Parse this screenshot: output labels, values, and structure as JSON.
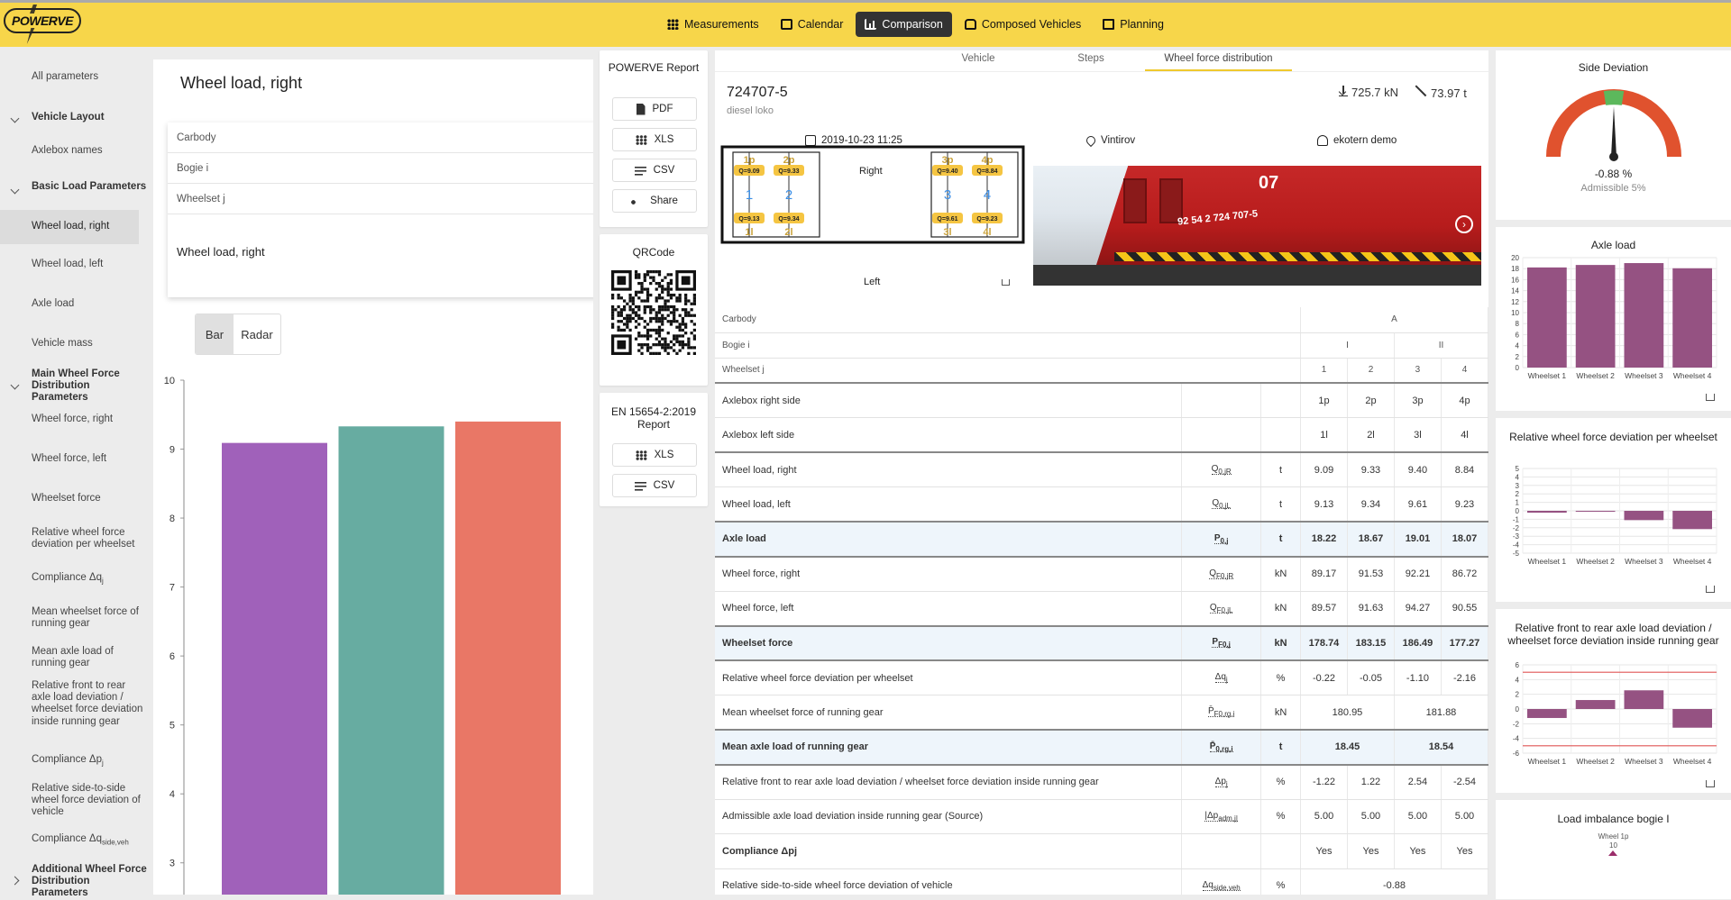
{
  "app": {
    "logo": "POWERVE"
  },
  "nav": [
    {
      "label": "Measurements",
      "icon": "grid-icon",
      "active": false
    },
    {
      "label": "Calendar",
      "icon": "calendar-icon",
      "active": false
    },
    {
      "label": "Comparison",
      "icon": "bar-chart-icon",
      "active": true
    },
    {
      "label": "Composed Vehicles",
      "icon": "train-icon",
      "active": false
    },
    {
      "label": "Planning",
      "icon": "clipboard-icon",
      "active": false
    }
  ],
  "sidebar": {
    "all": "All parameters",
    "sections": [
      {
        "label": "Vehicle Layout"
      },
      {
        "label": "Axlebox names"
      },
      {
        "label": "Basic Load Parameters"
      },
      {
        "label": "Wheel load, right"
      },
      {
        "label": "Wheel load, left"
      },
      {
        "label": "Axle load"
      },
      {
        "label": "Vehicle mass"
      },
      {
        "label": "Main Wheel Force Distribution Parameters"
      },
      {
        "label": "Wheel force, right"
      },
      {
        "label": "Wheel force, left"
      },
      {
        "label": "Wheelset force"
      },
      {
        "label": "Relative wheel force deviation per wheelset"
      },
      {
        "label": "Compliance Δq"
      },
      {
        "label": "Mean wheelset force of running gear"
      },
      {
        "label": "Mean axle load of running gear"
      },
      {
        "label": "Relative front to rear axle load deviation / wheelset force deviation inside running gear"
      },
      {
        "label": "Compliance Δp"
      },
      {
        "label": "Relative side-to-side wheel force deviation of vehicle"
      },
      {
        "label": "Compliance Δq"
      },
      {
        "label": "Additional Wheel Force Distribution Parameters"
      }
    ],
    "sub_j": "j",
    "sub_side": "side,veh"
  },
  "middle": {
    "title": "Wheel load, right",
    "filters": [
      "Carbody",
      "Bogie i",
      "Wheelset j"
    ],
    "value_label": "Wheel load, right",
    "view_bar": "Bar",
    "view_radar": "Radar"
  },
  "mid_chart": {
    "y_ticks": [
      "10",
      "9",
      "8",
      "7",
      "6",
      "5",
      "4",
      "3"
    ]
  },
  "chart_data": [
    {
      "type": "bar",
      "title": "",
      "categories": [
        "",
        "",
        ""
      ],
      "values": [
        9.09,
        9.33,
        9.4
      ],
      "ylim": [
        2.5,
        10
      ],
      "colors": [
        "#9b59b6",
        "#5fa89c",
        "#e8705e"
      ],
      "yticks": [
        3,
        4,
        5,
        6,
        7,
        8,
        9,
        10
      ]
    },
    {
      "type": "bar",
      "title": "Axle load",
      "categories": [
        "Wheelset 1",
        "Wheelset 2",
        "Wheelset 3",
        "Wheelset 4"
      ],
      "values": [
        18.22,
        18.67,
        19.01,
        18.07
      ],
      "yticks": [
        0,
        2,
        4,
        6,
        8,
        10,
        12,
        14,
        16,
        18,
        20
      ],
      "ylim": [
        0,
        20
      ]
    },
    {
      "type": "bar",
      "title": "Relative wheel force deviation per wheelset",
      "categories": [
        "Wheelset 1",
        "Wheelset 2",
        "Wheelset 3",
        "Wheelset 4"
      ],
      "values": [
        -0.22,
        -0.05,
        -1.1,
        -2.16
      ],
      "yticks": [
        5,
        4,
        3,
        2,
        1,
        0,
        -1,
        -2,
        -3,
        -4,
        -5
      ],
      "ylim": [
        -5,
        5
      ]
    },
    {
      "type": "bar",
      "title": "Relative front to rear axle load deviation / wheelset force deviation inside running gear",
      "categories": [
        "Wheelset 1",
        "Wheelset 2",
        "Wheelset 3",
        "Wheelset 4"
      ],
      "values": [
        -1.22,
        1.22,
        2.54,
        -2.54
      ],
      "yticks": [
        6,
        4,
        2,
        0,
        -2,
        -4,
        -6
      ],
      "ylim": [
        -6,
        6
      ],
      "limits": [
        5,
        -5
      ]
    }
  ],
  "report": {
    "title": "POWERVE Report",
    "pdf": "PDF",
    "xls": "XLS",
    "csv": "CSV",
    "share": "Share",
    "qr_title": "QRCode",
    "en_title": "EN 15654-2:2019 Report",
    "en_xls": "XLS",
    "en_csv": "CSV"
  },
  "tabs": [
    "Vehicle",
    "Steps",
    "Wheel force distribution"
  ],
  "vehicle": {
    "id": "724707-5",
    "type": "diesel loko",
    "force": "725.7 kN",
    "mass": "73.97 t",
    "date": "2019-10-23 11:25",
    "place": "Vintirov",
    "user": "ekotern demo",
    "right_label": "Right",
    "left_label": "Left",
    "photo_text": "92 54 2 724 707-5",
    "photo_num": "07"
  },
  "diagram": {
    "top_labels": [
      "1p",
      "2p",
      "3p",
      "4p"
    ],
    "bot_labels": [
      "1l",
      "2l",
      "3l",
      "4l"
    ],
    "q_top": [
      "Q=9.09",
      "Q=9.33",
      "Q=9.40",
      "Q=8.84"
    ],
    "q_bot": [
      "Q=9.13",
      "Q=9.34",
      "Q=9.61",
      "Q=9.23"
    ],
    "nums": [
      "1",
      "2",
      "3",
      "4"
    ]
  },
  "table": {
    "hdr": [
      {
        "label": "Carbody",
        "cells": [
          "A"
        ]
      },
      {
        "label": "Bogie i",
        "cells": [
          "I",
          "II"
        ]
      },
      {
        "label": "Wheelset j",
        "cells": [
          "1",
          "2",
          "3",
          "4"
        ]
      }
    ],
    "rows": [
      {
        "label": "Axlebox right side",
        "sym": "",
        "unit": "",
        "vals": [
          "1p",
          "2p",
          "3p",
          "4p"
        ]
      },
      {
        "label": "Axlebox left side",
        "sym": "",
        "unit": "",
        "vals": [
          "1l",
          "2l",
          "3l",
          "4l"
        ]
      },
      {
        "label": "Wheel load, right",
        "sym": "Q0,jR",
        "unit": "t",
        "vals": [
          "9.09",
          "9.33",
          "9.40",
          "8.84"
        ]
      },
      {
        "label": "Wheel load, left",
        "sym": "Q0,jL",
        "unit": "t",
        "vals": [
          "9.13",
          "9.34",
          "9.61",
          "9.23"
        ]
      },
      {
        "label": "Axle load",
        "sym": "P0,j",
        "unit": "t",
        "vals": [
          "18.22",
          "18.67",
          "19.01",
          "18.07"
        ],
        "hi": true
      },
      {
        "label": "Wheel force, right",
        "sym": "QF0,jR",
        "unit": "kN",
        "vals": [
          "89.17",
          "91.53",
          "92.21",
          "86.72"
        ]
      },
      {
        "label": "Wheel force, left",
        "sym": "QF0,jL",
        "unit": "kN",
        "vals": [
          "89.57",
          "91.63",
          "94.27",
          "90.55"
        ]
      },
      {
        "label": "Wheelset force",
        "sym": "PF0,j",
        "unit": "kN",
        "vals": [
          "178.74",
          "183.15",
          "186.49",
          "177.27"
        ],
        "hi": true
      },
      {
        "label": "Relative wheel force deviation per wheelset",
        "sym": "Δqj",
        "unit": "%",
        "vals": [
          "-0.22",
          "-0.05",
          "-1.10",
          "-2.16"
        ]
      },
      {
        "label": "Mean wheelset force of running gear",
        "sym": "P̄F0,rg,i",
        "unit": "kN",
        "pair": [
          "180.95",
          "181.88"
        ]
      },
      {
        "label": "Mean axle load of running gear",
        "sym": "P̄0,rg,i",
        "unit": "t",
        "pair": [
          "18.45",
          "18.54"
        ],
        "hi": true
      },
      {
        "label": "Relative front to rear axle load deviation / wheelset force deviation inside running gear",
        "sym": "Δpj",
        "unit": "%",
        "vals": [
          "-1.22",
          "1.22",
          "2.54",
          "-2.54"
        ]
      },
      {
        "label": "Admissible axle load deviation inside running gear (Source)",
        "sym": "|Δpadm,j|",
        "unit": "%",
        "vals": [
          "5.00",
          "5.00",
          "5.00",
          "5.00"
        ]
      },
      {
        "label": "Compliance Δpj",
        "sym": "",
        "unit": "",
        "vals": [
          "Yes",
          "Yes",
          "Yes",
          "Yes"
        ],
        "bold": true
      },
      {
        "label": "Relative side-to-side wheel force deviation of vehicle",
        "sym": "Δqside,veh",
        "unit": "%",
        "single": "-0.88"
      }
    ]
  },
  "right": {
    "side_title": "Side Deviation",
    "side_value": "-0.88 %",
    "side_adm": "Admissible 5%",
    "load_imb_title": "Load imbalance bogie I",
    "load_imb_sub": "Wheel 1p",
    "load_imb_tick": "10"
  }
}
